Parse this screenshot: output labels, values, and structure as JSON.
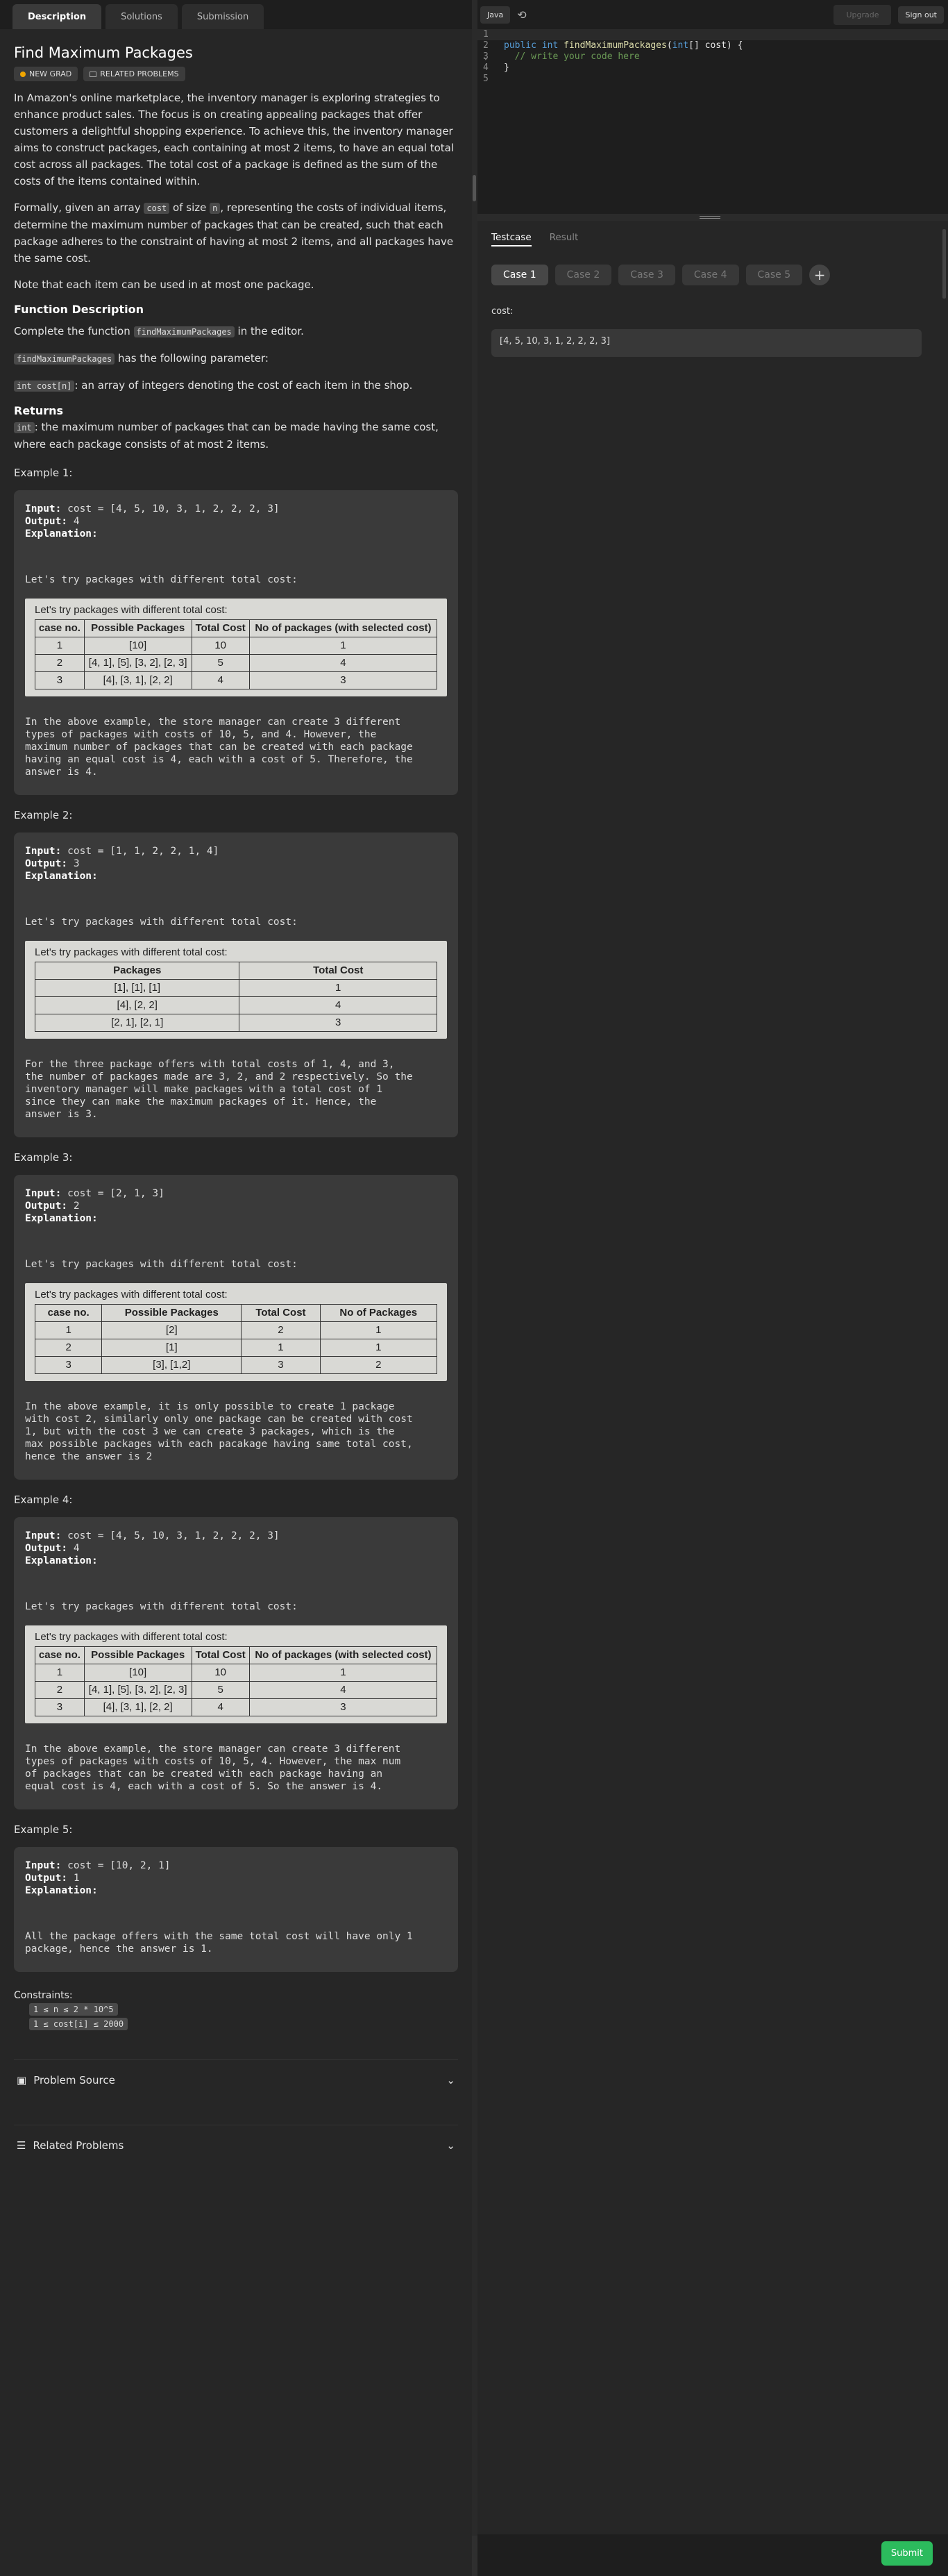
{
  "tabs": [
    "Description",
    "Solutions",
    "Submission"
  ],
  "title": "Find Maximum Packages",
  "badges": {
    "new": "NEW GRAD",
    "related": "RELATED PROBLEMS"
  },
  "para1": "In Amazon's online marketplace, the inventory manager is exploring strategies to enhance product sales. The focus is on creating appealing packages that offer customers a delightful shopping experience. To achieve this, the inventory manager aims to construct packages, each containing at most 2 items, to have an equal total cost across all packages. The total cost of a package is defined as the sum of the costs of the items contained within.",
  "para2": {
    "a": "Formally, given an array ",
    "code1": "cost",
    "b": " of size ",
    "code2": "n",
    "c": ", representing the costs of individual items, determine the maximum number of packages that can be created, such that each package adheres to the constraint of having at most 2 items, and all packages have the same cost."
  },
  "para3": "Note that each item can be used in at most one package.",
  "fd_title": "Function Description",
  "fd1": {
    "a": "Complete the function ",
    "code": "findMaximumPackages",
    "b": " in the editor."
  },
  "fd2": {
    "code": "findMaximumPackages",
    "b": " has the following parameter:"
  },
  "fd3": {
    "code": "int cost[n]",
    "b": ": an array of integers denoting the cost of each item in the shop."
  },
  "returns_title": "Returns",
  "returns": {
    "code": "int",
    "b": ": the maximum number of packages that can be made having the same cost, where each package consists of at most 2 items."
  },
  "labels": {
    "input": "Input:",
    "output": "Output:",
    "explanation": "Explanation:"
  },
  "examples": [
    {
      "title": "Example 1:",
      "input": "cost = [4, 5, 10, 3, 1, 2, 2, 2, 3]",
      "output": "4",
      "sub": "Let's try packages with different total cost:",
      "photo": {
        "cap": "Let's try packages with different total cost:",
        "headers": [
          "case no.",
          "Possible Packages",
          "Total Cost",
          "No of packages (with selected cost)"
        ],
        "rows": [
          [
            "1",
            "[10]",
            "10",
            "1"
          ],
          [
            "2",
            "[4, 1], [5], [3, 2], [2, 3]",
            "5",
            "4"
          ],
          [
            "3",
            "[4], [3, 1], [2, 2]",
            "4",
            "3"
          ]
        ]
      },
      "after": "In the above example, the store manager can create 3 different\ntypes of packages with costs of 10, 5, and 4. However, the\nmaximum number of packages that can be created with each package\nhaving an equal cost is 4, each with a cost of 5. Therefore, the\nanswer is 4."
    },
    {
      "title": "Example 2:",
      "input": "cost = [1, 1, 2, 2, 1, 4]",
      "output": "3",
      "sub": "Let's try packages with different total cost:",
      "photo": {
        "cap": "Let's try packages with different total cost:",
        "headers": [
          "Packages",
          "Total Cost"
        ],
        "rows": [
          [
            "[1], [1], [1]",
            "1"
          ],
          [
            "[4], [2, 2]",
            "4"
          ],
          [
            "[2, 1], [2, 1]",
            "3"
          ]
        ]
      },
      "after": "For the three package offers with total costs of 1, 4, and 3,\nthe number of packages made are 3, 2, and 2 respectively. So the\ninventory manager will make packages with a total cost of 1\nsince they can make the maximum packages of it. Hence, the\nanswer is 3."
    },
    {
      "title": "Example 3:",
      "input": "cost = [2, 1, 3]",
      "output": "2",
      "sub": "Let's try packages with different total cost:",
      "photo": {
        "cap": "Let's try packages with different total cost:",
        "headers": [
          "case no.",
          "Possible Packages",
          "Total Cost",
          "No of Packages"
        ],
        "rows": [
          [
            "1",
            "[2]",
            "2",
            "1"
          ],
          [
            "2",
            "[1]",
            "1",
            "1"
          ],
          [
            "3",
            "[3], [1,2]",
            "3",
            "2"
          ]
        ]
      },
      "after": "In the above example, it is only possible to create 1 package\nwith cost 2, similarly only one package can be created with cost\n1, but with the cost 3 we can create 3 packages, which is the\nmax possible packages with each pacakage having same total cost,\nhence the answer is 2"
    },
    {
      "title": "Example 4:",
      "input": "cost = [4, 5, 10, 3, 1, 2, 2, 2, 3]",
      "output": "4",
      "sub": "Let's try packages with different total cost:",
      "photo": {
        "cap": "Let's try packages with different total cost:",
        "headers": [
          "case no.",
          "Possible Packages",
          "Total Cost",
          "No of packages (with selected cost)"
        ],
        "rows": [
          [
            "1",
            "[10]",
            "10",
            "1"
          ],
          [
            "2",
            "[4, 1], [5], [3, 2], [2, 3]",
            "5",
            "4"
          ],
          [
            "3",
            "[4], [3, 1], [2, 2]",
            "4",
            "3"
          ]
        ]
      },
      "after": "In the above example, the store manager can create 3 different\ntypes of packages with costs of 10, 5, 4. However, the max num\nof packages that can be created with each package having an\nequal cost is 4, each with a cost of 5. So the answer is 4."
    },
    {
      "title": "Example 5:",
      "input": "cost = [10, 2, 1]",
      "output": "1",
      "sub": "All the package offers with the same total cost will have only 1\npackage, hence the answer is 1.",
      "photo": null,
      "after": ""
    }
  ],
  "constraints": {
    "title": "Constraints:",
    "c1": "1 ≤ n ≤ 2 * 10^5",
    "c2": "1 ≤ cost[i] ≤ 2000"
  },
  "problem_source": "Problem Source",
  "related_problems": "Related Problems",
  "topbar": {
    "lang": "Java",
    "upgrade": "Upgrade",
    "signout": "Sign out"
  },
  "code_lines": [
    "",
    "public int findMaximumPackages(int[] cost) {",
    "  // write your code here",
    "}",
    ""
  ],
  "panel": {
    "testcase": "Testcase",
    "result": "Result",
    "cases": [
      "Case 1",
      "Case 2",
      "Case 3",
      "Case 4",
      "Case 5"
    ],
    "cost_label": "cost:",
    "cost_value": "[4, 5, 10, 3, 1, 2, 2, 2, 3]"
  },
  "submit": "Submit"
}
